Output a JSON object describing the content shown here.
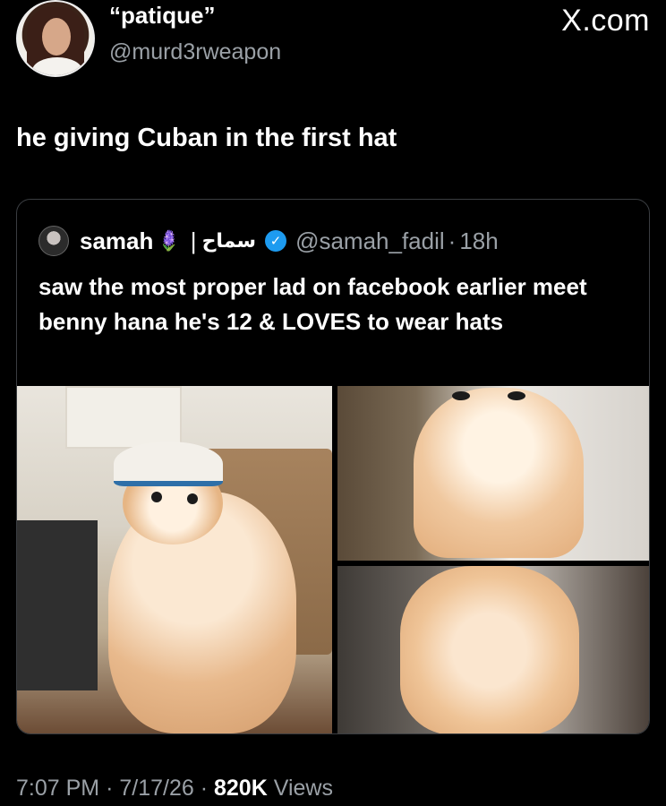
{
  "header": {
    "display_name": "“patique”",
    "handle": "@murd3rweapon",
    "site": "X.com"
  },
  "tweet": {
    "text": "he giving Cuban in the first hat"
  },
  "quoted": {
    "name": "samah",
    "flower": "🪻",
    "separator": "|",
    "arabic_name": "سماح",
    "verified_mark": "✓",
    "handle": "@samah_fadil",
    "dot": "·",
    "time": "18h",
    "text": "saw the most proper lad on facebook earlier meet benny hana he's 12 & LOVES to wear hats"
  },
  "footer": {
    "time": "7:07 PM",
    "dot1": "·",
    "date": "7/17/26",
    "dot2": "·",
    "views_count": "820K",
    "views_label": "Views"
  },
  "colors": {
    "background": "#000000",
    "text": "#ffffff",
    "muted": "#9aa0a6",
    "verified": "#1d9bf0",
    "border": "#3a3d41"
  }
}
